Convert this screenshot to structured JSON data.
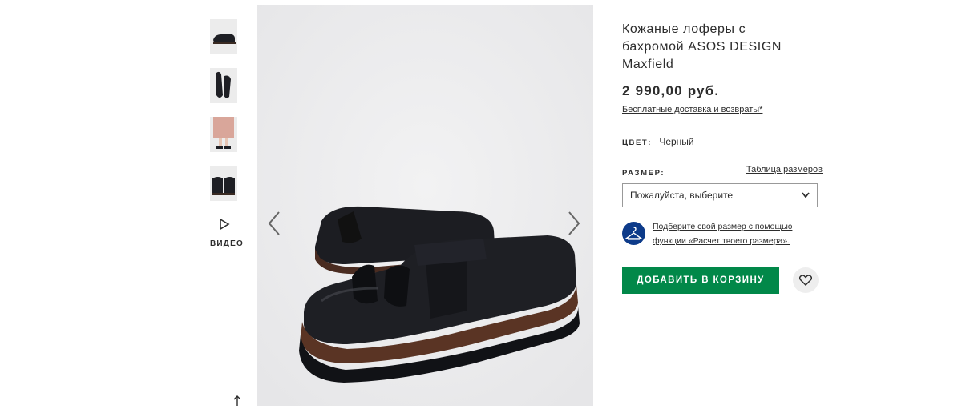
{
  "gallery": {
    "thumbnails": [
      {
        "icon": "shoe-side-thumbnail"
      },
      {
        "icon": "shoe-top-thumbnail"
      },
      {
        "icon": "model-legs-thumbnail"
      },
      {
        "icon": "shoe-back-thumbnail"
      }
    ],
    "video_label": "ВИДЕО"
  },
  "product": {
    "title_line1": "Кожаные лоферы с",
    "title_line2": "бахромой ASOS DESIGN",
    "title_line3": "Maxfield",
    "price": "2 990,00 руб.",
    "delivery_link": "Бесплатные доставка и возвраты*",
    "color_label": "ЦВЕТ:",
    "color_value": "Черный",
    "size_label": "РАЗМЕР:",
    "size_table_link": "Таблица размеров",
    "size_select_value": "Пожалуйста, выберите",
    "fit_line1": "Подберите свой размер с помощью",
    "fit_line2": "функции «Расчет твоего размера».",
    "add_to_bag": "ДОБАВИТЬ В КОРЗИНУ"
  },
  "colors": {
    "accent_green": "#018849",
    "fit_icon_blue": "#0d3b8a",
    "image_bg": "#efefef",
    "shoe": "#1e1f24"
  }
}
